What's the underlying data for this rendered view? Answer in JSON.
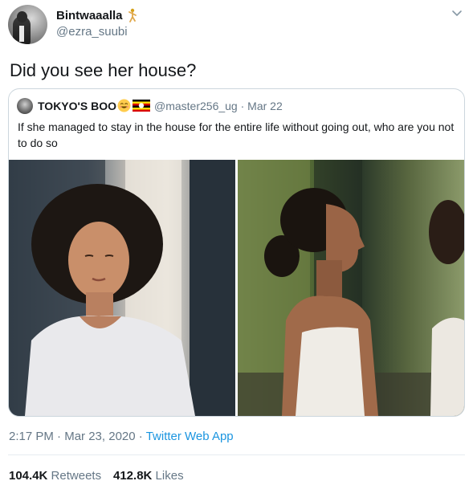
{
  "author": {
    "display_name": "Bintwaaalla",
    "handle": "@ezra_suubi",
    "name_emoji": "dancing-figure-emoji"
  },
  "tweet": {
    "text": "Did you see her house?"
  },
  "quoted_tweet": {
    "display_name": "TOKYO'S BOO",
    "emojis": [
      "smiling-face-emoji",
      "uganda-flag-emoji"
    ],
    "handle": "@master256_ug",
    "separator": "·",
    "date": "Mar 22",
    "text": "If she managed to stay in the house for the entire life without going out, who are you not to do so",
    "images": [
      {
        "name": "photo-girl-curly-hair-white-tee"
      },
      {
        "name": "photo-girl-profile-white-tank"
      }
    ]
  },
  "meta": {
    "time": "2:17 PM",
    "separator": "·",
    "date": "Mar 23, 2020",
    "source": "Twitter Web App"
  },
  "stats": {
    "retweets_count": "104.4K",
    "retweets_label": "Retweets",
    "likes_count": "412.8K",
    "likes_label": "Likes"
  },
  "colors": {
    "text": "#14171a",
    "secondary": "#657786",
    "link": "#1b95e0",
    "border": "#ccd6dd"
  }
}
